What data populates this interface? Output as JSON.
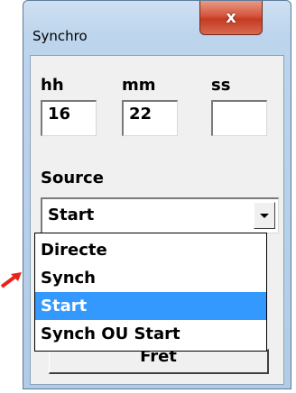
{
  "window": {
    "title": "Synchro",
    "close_glyph": "x"
  },
  "time": {
    "labels": [
      "hh",
      "mm",
      "ss"
    ],
    "values": [
      "16",
      "22",
      ""
    ]
  },
  "source": {
    "label": "Source",
    "selected": "Start",
    "options": [
      "Directe",
      "Synch",
      "Start",
      "Synch OU Start"
    ],
    "highlighted_index": 2
  },
  "button": {
    "label": "Fret"
  },
  "colors": {
    "highlight": "#3399ff",
    "pointer": "#e8231b"
  },
  "icons": [
    "close-icon",
    "chevron-down-icon",
    "red-arrow-pointer"
  ]
}
